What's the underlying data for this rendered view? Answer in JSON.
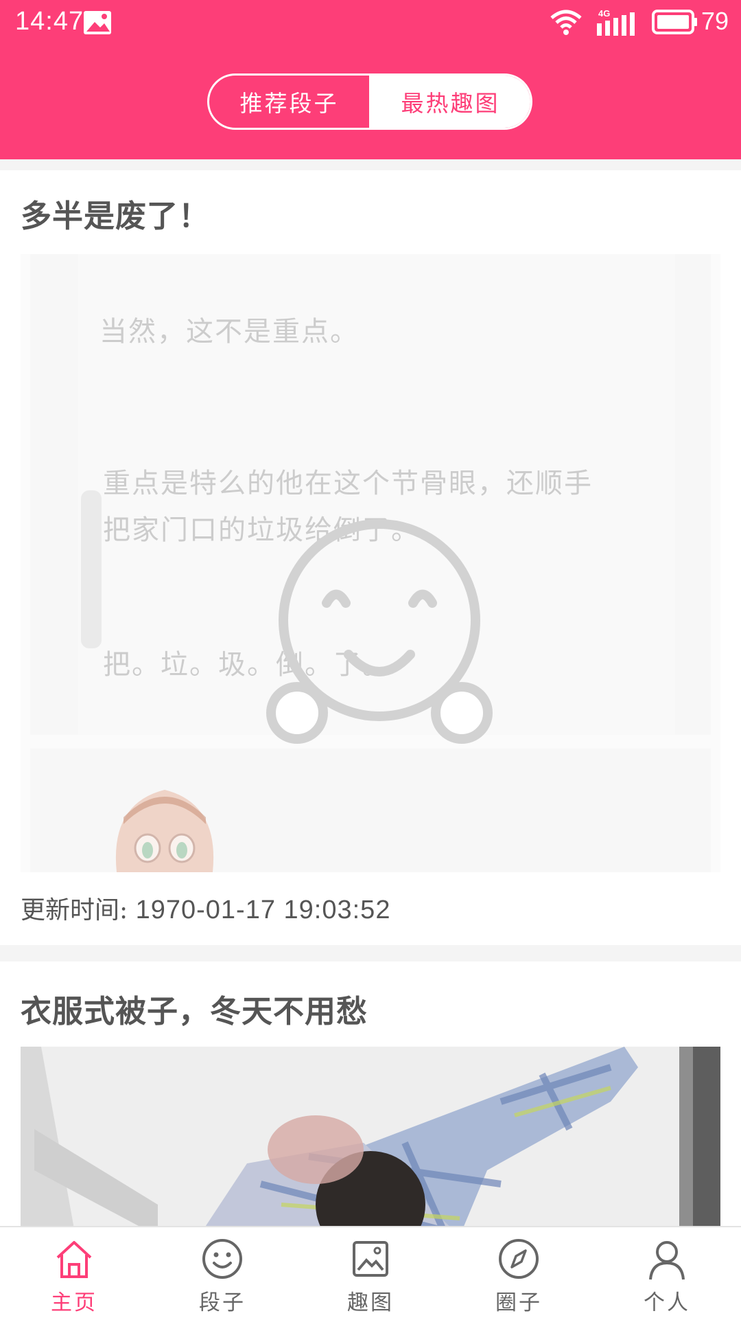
{
  "status_bar": {
    "time": "14:47",
    "network": "4G",
    "battery": "79",
    "icons": [
      "image-icon",
      "wifi-icon",
      "signal-icon",
      "battery-icon"
    ]
  },
  "header": {
    "tabs": [
      {
        "label": "推荐段子",
        "selected": false
      },
      {
        "label": "最热趣图",
        "selected": true
      }
    ],
    "accent_color": "#fd3e78"
  },
  "feed": {
    "posts": [
      {
        "title": "多半是废了！",
        "image_text": [
          "当然，这不是重点。",
          "重点是特么的他在这个节骨眼，还顺手",
          "把家门口的垃圾给倒了。",
          "把。垃。圾。倒。了。"
        ],
        "update_label": "更新时间:",
        "update_time": "1970-01-17  19:03:52"
      },
      {
        "title": "衣服式被子，冬天不用愁"
      }
    ]
  },
  "bottom_nav": {
    "items": [
      {
        "label": "主页",
        "icon": "home-icon",
        "active": true
      },
      {
        "label": "段子",
        "icon": "smiley-icon",
        "active": false
      },
      {
        "label": "趣图",
        "icon": "picture-icon",
        "active": false
      },
      {
        "label": "圈子",
        "icon": "compass-icon",
        "active": false
      },
      {
        "label": "个人",
        "icon": "person-icon",
        "active": false
      }
    ]
  }
}
